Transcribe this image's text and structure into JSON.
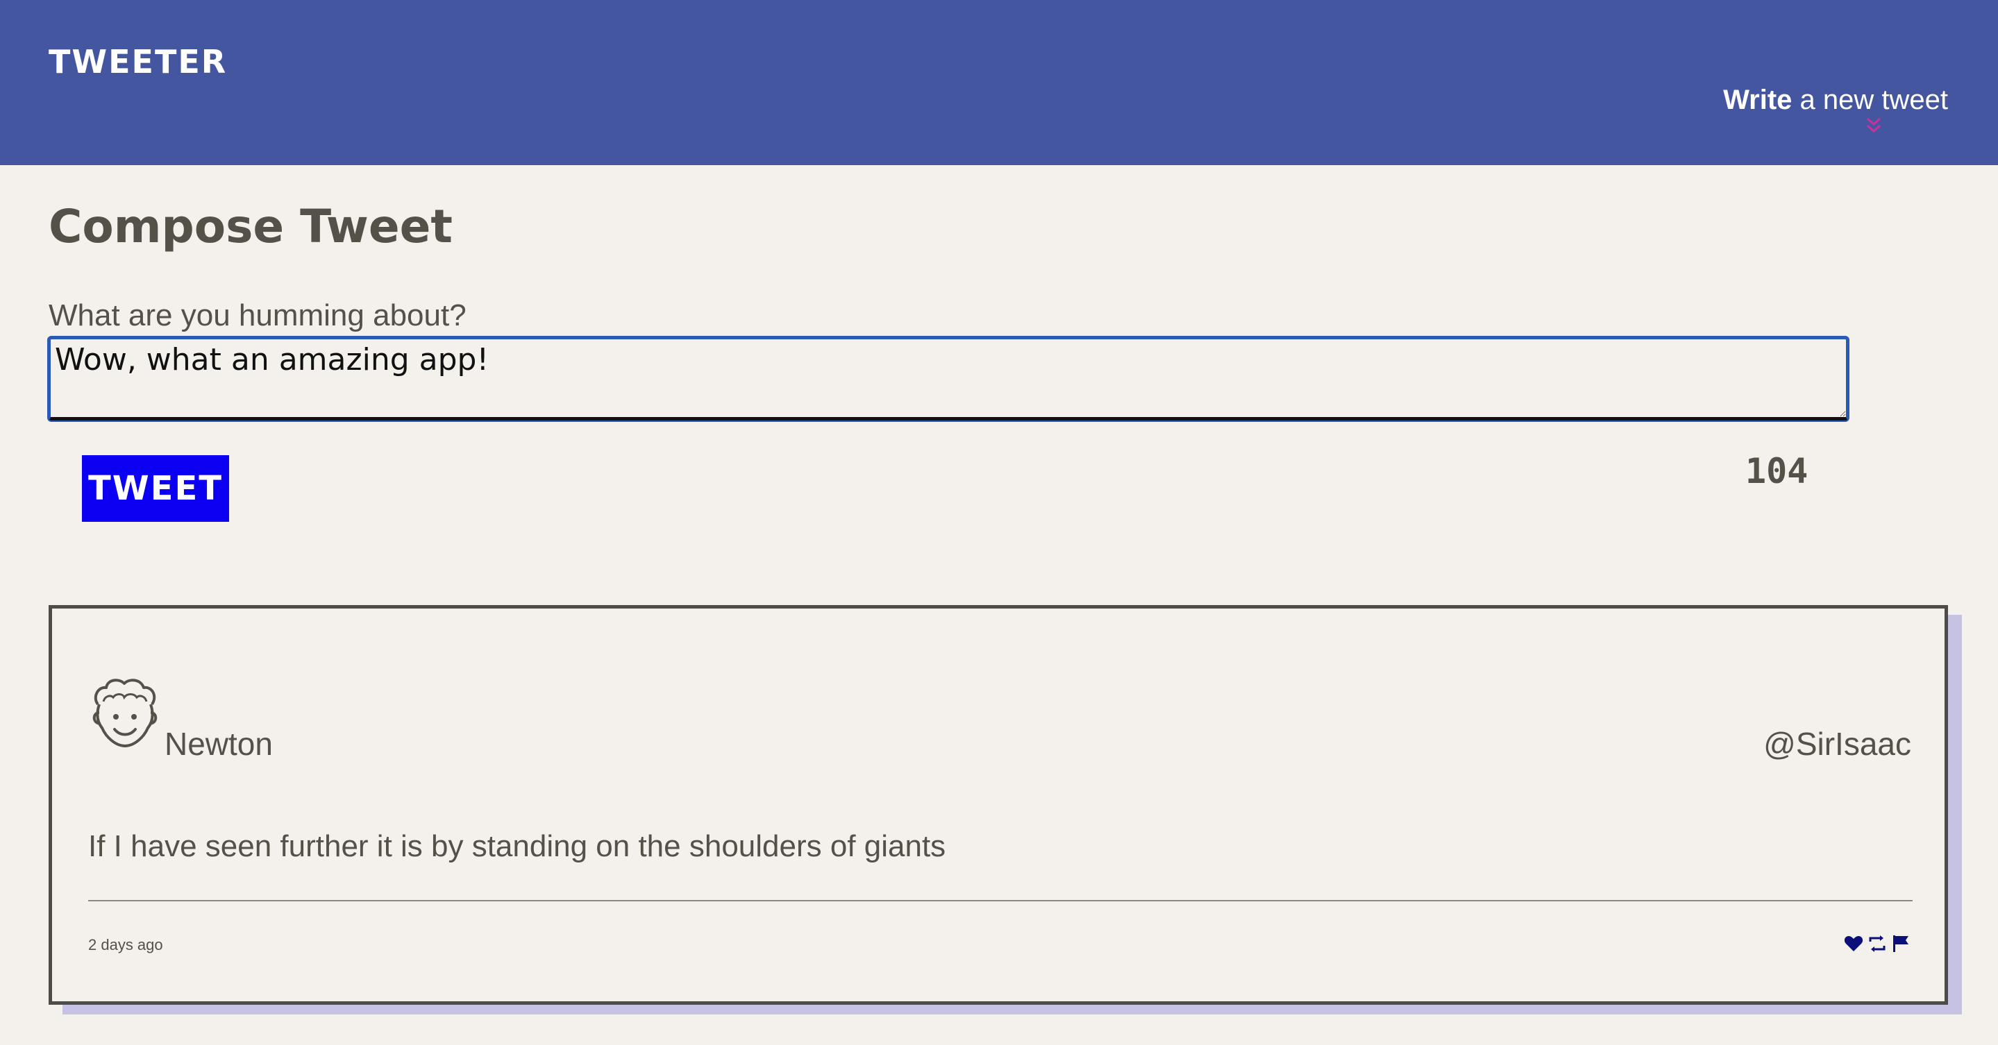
{
  "header": {
    "brand": "TWEETER",
    "write_strong": "Write",
    "write_rest": " a new tweet",
    "chevron_icon": "double-chevron-down-icon",
    "chevron_color": "#c7339a",
    "background": "#4556a0"
  },
  "compose": {
    "title": "Compose Tweet",
    "label": "What are you humming about?",
    "textarea_value": "Wow, what an amazing app!",
    "tweet_button_label": "TWEET",
    "tweet_button_color": "#0b00f2",
    "char_count": "104"
  },
  "tweet": {
    "avatar_icon": "avatar-face-icon",
    "author_name": "Newton",
    "author_handle": "@SirIsaac",
    "content": "If I have seen further it is by standing on the shoulders of giants",
    "timestamp": "2 days ago",
    "actions": [
      "heart-icon",
      "retweet-icon",
      "flag-icon"
    ],
    "action_color": "#0b0f7a"
  }
}
